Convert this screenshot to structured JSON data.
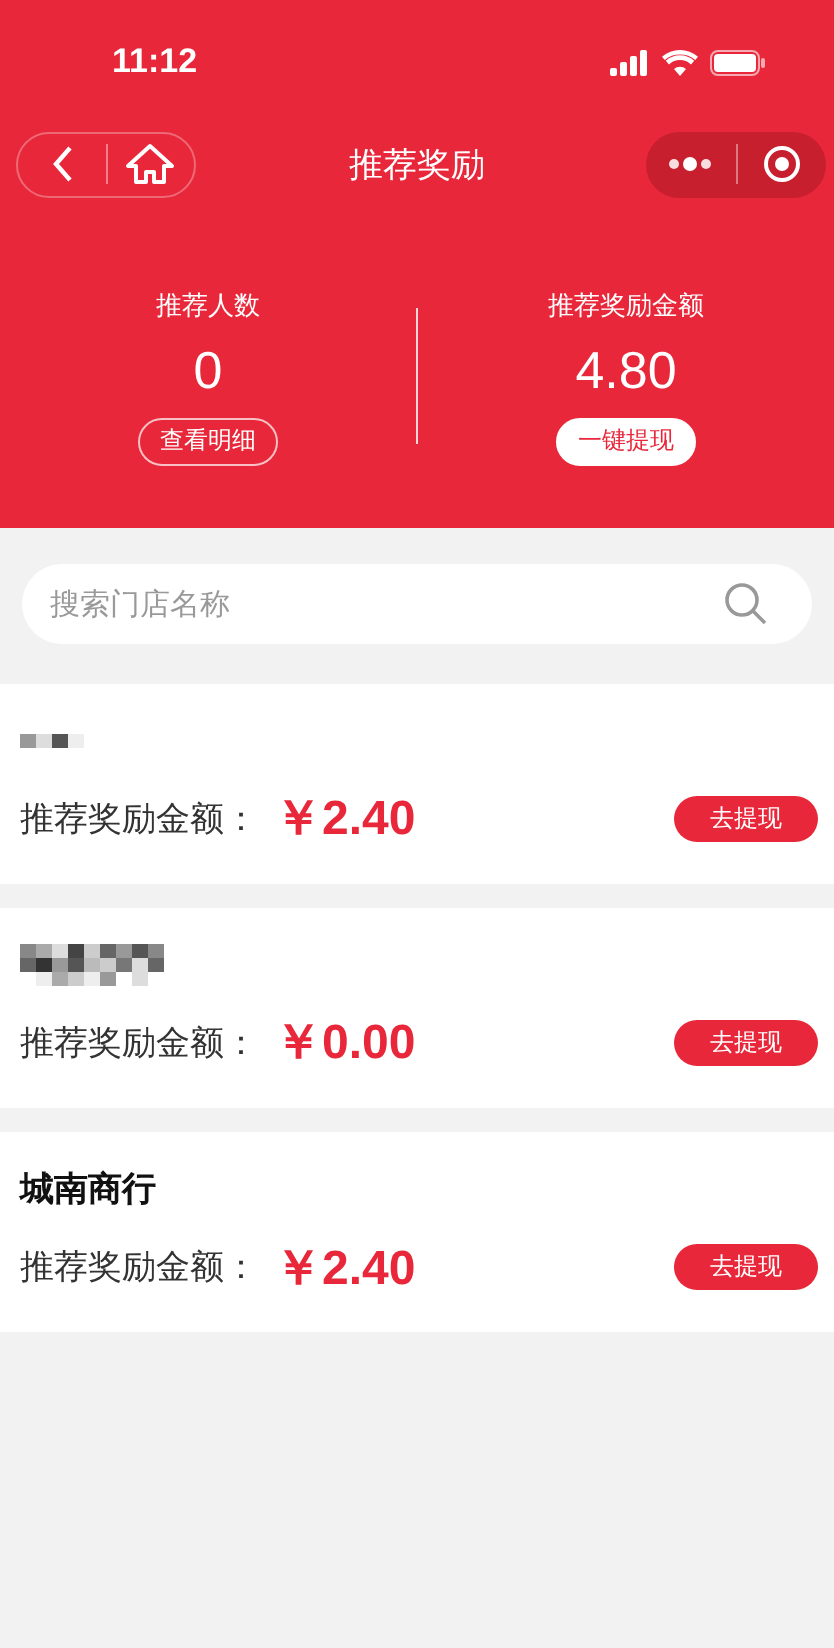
{
  "status_bar": {
    "time": "11:12"
  },
  "nav": {
    "title": "推荐奖励"
  },
  "stats": [
    {
      "label": "推荐人数",
      "value": "0",
      "action": "查看明细",
      "kind": "outline"
    },
    {
      "label": "推荐奖励金额",
      "value": "4.80",
      "action": "一键提现",
      "kind": "filled"
    }
  ],
  "search": {
    "placeholder": "搜索门店名称"
  },
  "stores": [
    {
      "kind": "redacted",
      "amount_label": "推荐奖励金额：",
      "amount": "￥2.40",
      "action": "去提现"
    },
    {
      "kind": "redacted_long",
      "amount_label": "推荐奖励金额：",
      "amount": "￥0.00",
      "action": "去提现"
    },
    {
      "kind": "name",
      "name": "城南商行",
      "amount_label": "推荐奖励金额：",
      "amount": "￥2.40",
      "action": "去提现"
    }
  ]
}
